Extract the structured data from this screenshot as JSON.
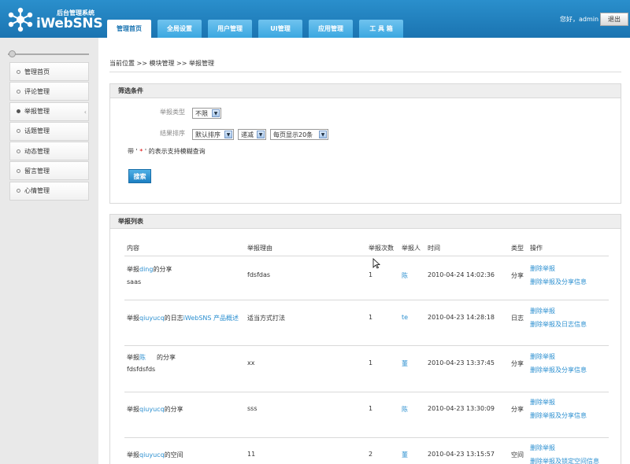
{
  "header": {
    "logo_sub": "后台管理系统",
    "logo_main": "iWebSNS",
    "greeting": "您好，admin",
    "logout": "退出",
    "tabs": [
      "管理首页",
      "全局设置",
      "用户管理",
      "UI管理",
      "应用管理",
      "工 具 箱"
    ],
    "active_tab": 0
  },
  "sidebar": {
    "items": [
      "管理首页",
      "评论管理",
      "举报管理",
      "话题管理",
      "动态管理",
      "留言管理",
      "心情管理"
    ],
    "active_index": 2
  },
  "breadcrumb": "当前位置 >> 模块管理 >> 举报管理",
  "filter": {
    "title": "筛选条件",
    "type_label": "举报类型",
    "type_value": "不限",
    "sort_label": "结果排序",
    "sort_value": "默认排序",
    "order_value": "递减",
    "page_value": "每页显示20条",
    "note_prefix": "带 '",
    "note_star": " * ",
    "note_suffix": "' 的表示支持模糊查询",
    "search_button": "搜索"
  },
  "list": {
    "title": "举报列表",
    "columns": [
      "内容",
      "举报理由",
      "举报次数",
      "举报人",
      "时间",
      "类型",
      "操作"
    ],
    "rows": [
      {
        "prefix": "举报",
        "name": "ding",
        "mid": "的分享",
        "extra": "",
        "line2": "saas",
        "reason": "fdsfdas",
        "count": "1",
        "reporter": "陈",
        "time": "2010-04-24 14:02:36",
        "type": "分享",
        "action1": "删除举报",
        "action2": "删除举报及分享信息"
      },
      {
        "prefix": "举报",
        "name": "qiuyucq",
        "mid": "的日志",
        "extra": "iWebSNS 产品概述",
        "line2": "",
        "reason": "适当方式打法",
        "count": "1",
        "reporter": "te",
        "time": "2010-04-23 14:28:18",
        "type": "日志",
        "action1": "删除举报",
        "action2": "删除举报及日志信息"
      },
      {
        "prefix": "举报",
        "name": "陈",
        "mid": "的分享",
        "extra": "",
        "line2": "fdsfdsfds",
        "reason": "xx",
        "count": "1",
        "reporter": "董",
        "time": "2010-04-23 13:37:45",
        "type": "分享",
        "action1": "删除举报",
        "action2": "删除举报及分享信息"
      },
      {
        "prefix": "举报",
        "name": "qiuyucq",
        "mid": "的分享",
        "extra": "",
        "line2": "",
        "reason": "sss",
        "count": "1",
        "reporter": "陈",
        "time": "2010-04-23 13:30:09",
        "type": "分享",
        "action1": "删除举报",
        "action2": "删除举报及分享信息"
      },
      {
        "prefix": "举报",
        "name": "qiuyucq",
        "mid": "的空间",
        "extra": "",
        "line2": "",
        "reason": "11",
        "count": "2",
        "reporter": "董",
        "time": "2010-04-23 13:15:57",
        "type": "空间",
        "action1": "删除举报",
        "action2": "删除举报及锁定空间信息"
      }
    ]
  }
}
